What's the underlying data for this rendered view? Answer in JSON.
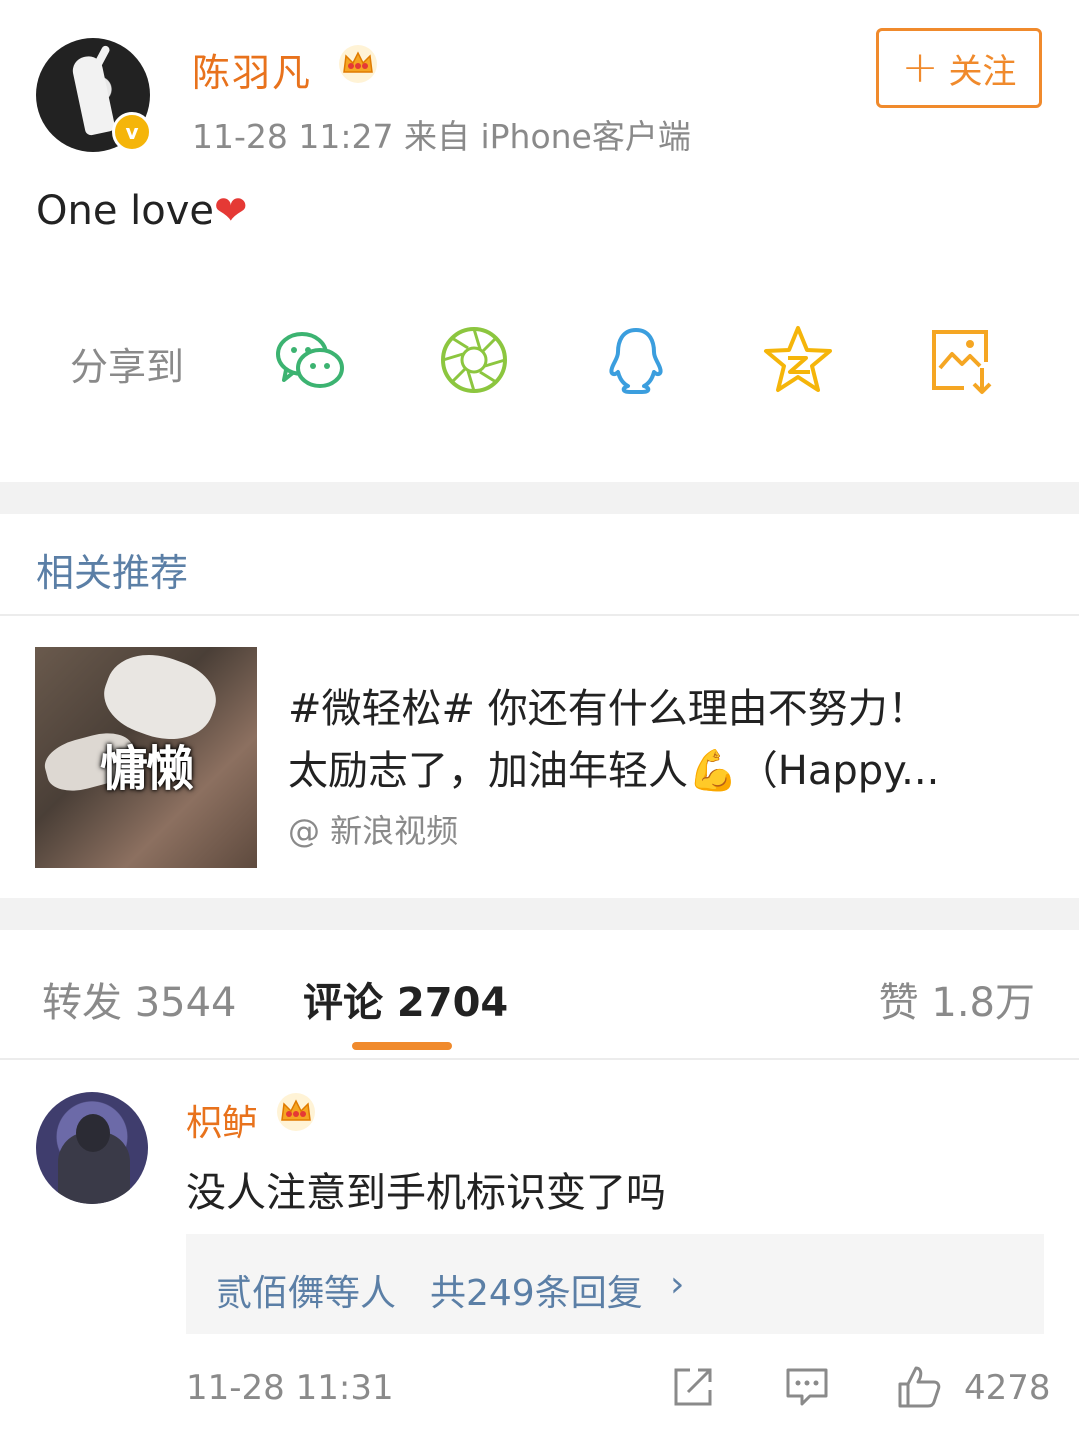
{
  "post": {
    "username": "陈羽凡",
    "meta": "11-28 11:27   来自 iPhone客户端",
    "text": "One love",
    "heart": "❤",
    "follow_plus": "+",
    "follow_label": "关注",
    "verify_glyph": "v"
  },
  "share": {
    "label": "分享到",
    "icons": [
      "wechat-icon",
      "moments-icon",
      "qq-icon",
      "qzone-icon",
      "save-image-icon"
    ]
  },
  "related": {
    "title": "相关推荐",
    "thumb_caption": "慵懒",
    "line1": "#微轻松# 你还有什么理由不努力！",
    "line2": "太励志了，加油年轻人💪（Happy...",
    "source": "@ 新浪视频"
  },
  "tabs": {
    "repost": "转发 3544",
    "comment": "评论 2704",
    "like": "赞 1.8万"
  },
  "comment": {
    "username": "枳鲈",
    "text": "没人注意到手机标识变了吗",
    "reply_who": "贰佰儛等人",
    "reply_count": "共249条回复",
    "reply_chevron": "›",
    "time": "11-28 11:31",
    "like_count": "4278"
  },
  "colors": {
    "accent_orange": "#f08a2c",
    "username_orange": "#e8721c",
    "link_blue": "#5b7fa6",
    "muted_gray": "#8a8a8a"
  }
}
